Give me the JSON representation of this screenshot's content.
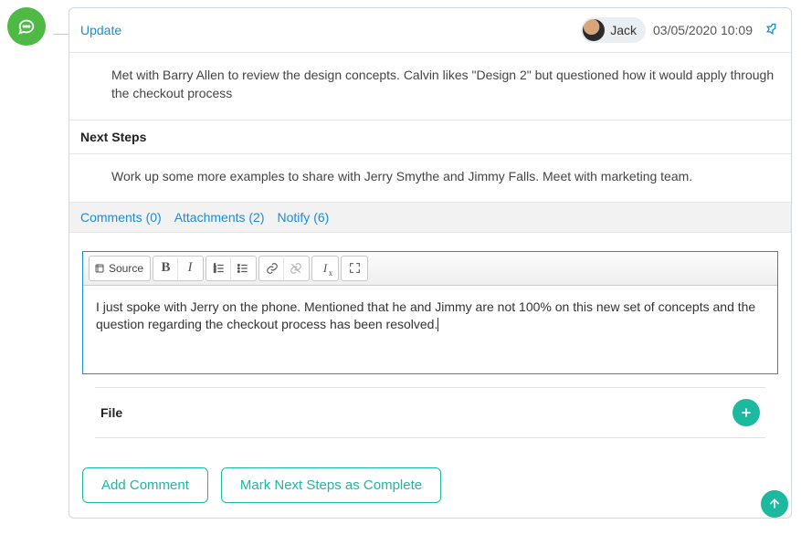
{
  "header": {
    "update_label": "Update",
    "user_name": "Jack",
    "timestamp": "03/05/2020 10:09"
  },
  "update_body": "Met with Barry Allen to review the design concepts. Calvin likes \"Design 2\" but questioned how it would apply through the checkout process",
  "next_steps": {
    "heading": "Next Steps",
    "body": "Work up some more examples to share with Jerry Smythe and Jimmy Falls. Meet with marketing team."
  },
  "tabs": {
    "comments": "Comments (0)",
    "attachments": "Attachments (2)",
    "notify": "Notify (6)"
  },
  "editor": {
    "source_label": "Source",
    "content": "I just spoke with Jerry on the phone. Mentioned that he and Jimmy are not 100% on this new set of concepts and the question regarding the checkout process has been resolved."
  },
  "file_section": {
    "label": "File"
  },
  "actions": {
    "add_comment": "Add Comment",
    "mark_complete": "Mark Next Steps as Complete"
  },
  "icons": {
    "timeline": "chat-icon",
    "pin": "pin-icon",
    "add_file": "plus-icon",
    "scroll_top": "arrow-up-icon"
  },
  "colors": {
    "accent_green": "#4fb946",
    "accent_teal": "#1cb8a0",
    "link_blue": "#1a8cd8"
  }
}
